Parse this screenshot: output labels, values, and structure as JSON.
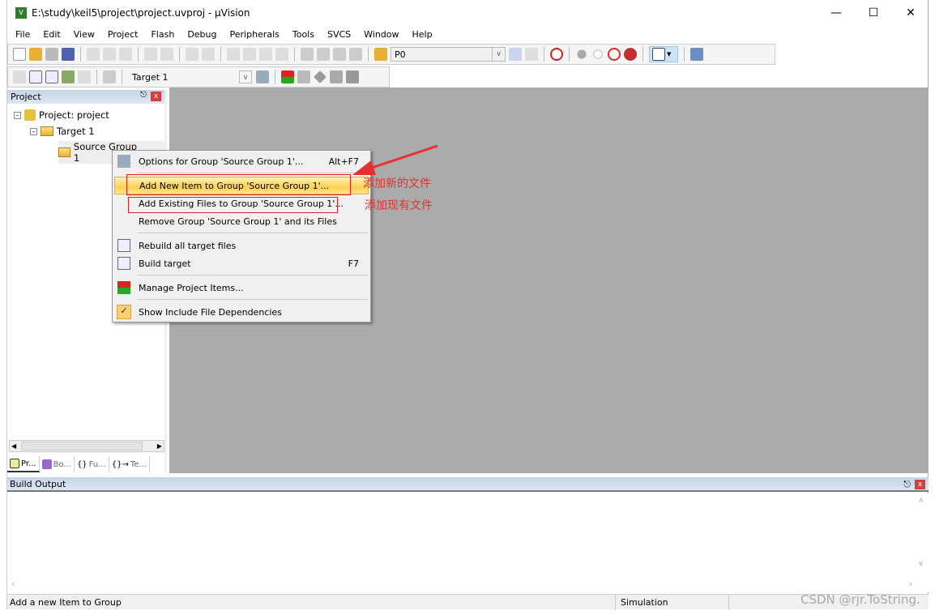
{
  "window": {
    "title": "E:\\study\\keil5\\project\\project.uvproj - µVision",
    "app_icon": "uvision-logo"
  },
  "menubar": [
    "File",
    "Edit",
    "View",
    "Project",
    "Flash",
    "Debug",
    "Peripherals",
    "Tools",
    "SVCS",
    "Window",
    "Help"
  ],
  "toolbar1": {
    "find_combo_value": "P0"
  },
  "toolbar2": {
    "target_combo_value": "Target 1"
  },
  "project_panel": {
    "title": "Project",
    "tree": [
      {
        "label": "Project: project",
        "level": 0
      },
      {
        "label": "Target 1",
        "level": 1
      },
      {
        "label": "Source Group 1",
        "level": 2
      }
    ],
    "tabs": [
      "Pr...",
      "Bo...",
      "Fu...",
      "Te..."
    ]
  },
  "context_menu": {
    "items": [
      {
        "label": "Options for Group 'Source Group 1'...",
        "shortcut": "Alt+F7",
        "icon": "magic-wand-icon"
      },
      {
        "label": "Add New  Item to Group 'Source Group 1'...",
        "shortcut": "",
        "highlighted": true
      },
      {
        "label": "Add Existing Files to Group 'Source Group 1'...",
        "shortcut": ""
      },
      {
        "label": "Remove Group 'Source Group 1' and its Files",
        "shortcut": ""
      },
      {
        "label": "Rebuild all target files",
        "shortcut": "",
        "icon": "rebuild-icon"
      },
      {
        "label": "Build target",
        "shortcut": "F7",
        "icon": "build-icon"
      },
      {
        "label": "Manage Project Items...",
        "shortcut": "",
        "icon": "manage-items-icon"
      },
      {
        "label": "Show Include File Dependencies",
        "shortcut": "",
        "checked": true
      }
    ]
  },
  "annotations": {
    "new_file": "添加新的文件",
    "existing_file": "添加现有文件",
    "color": "#e53030"
  },
  "build_output": {
    "title": "Build Output"
  },
  "status_bar": {
    "message": "Add a new Item to Group",
    "mode": "Simulation"
  },
  "watermark": "CSDN @rjr.ToString."
}
